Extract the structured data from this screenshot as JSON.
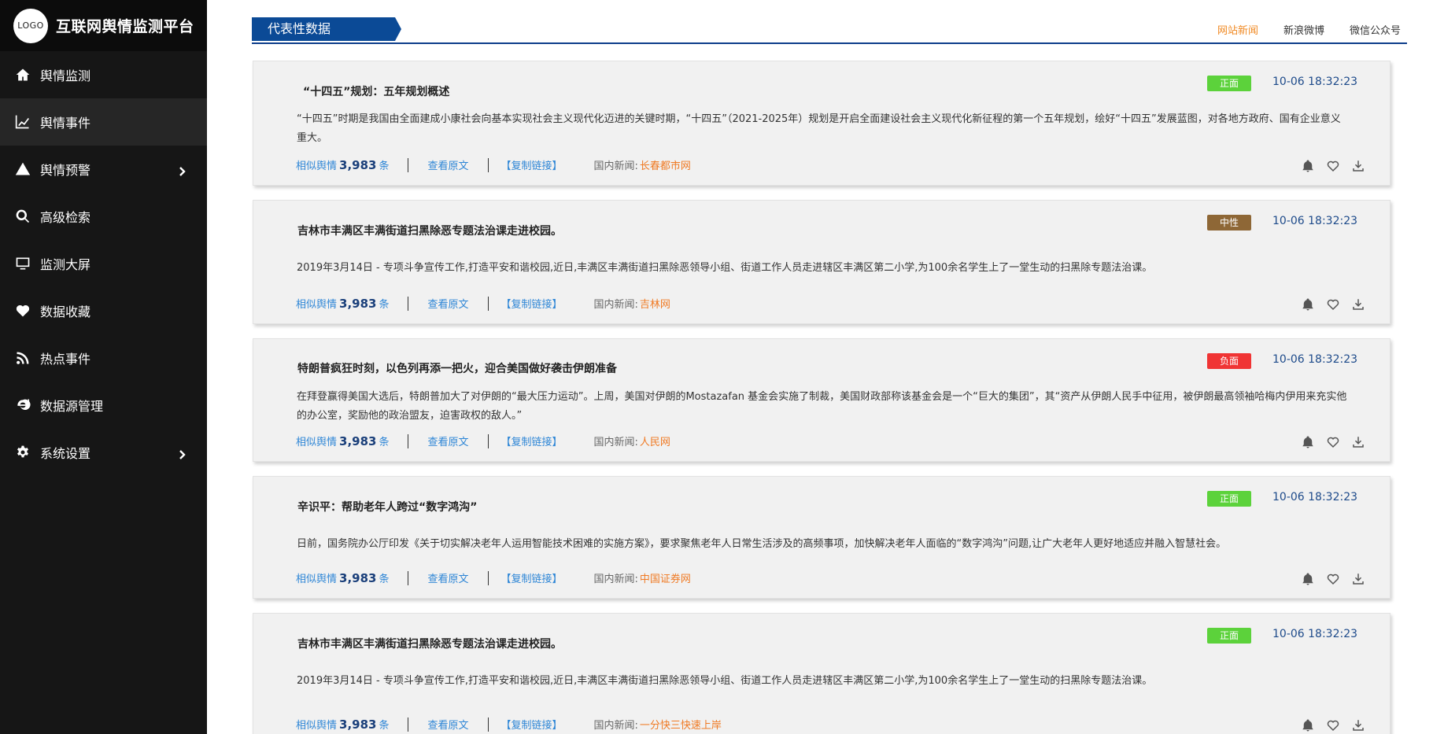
{
  "app": {
    "logo_text": "LOGO",
    "title": "互联网舆情监测平台"
  },
  "sidebar": {
    "items": [
      {
        "label": "舆情监测",
        "icon": "home-icon"
      },
      {
        "label": "舆情事件",
        "icon": "line-chart-icon"
      },
      {
        "label": "舆情预警",
        "icon": "warning-icon"
      },
      {
        "label": "高级检索",
        "icon": "search-icon"
      },
      {
        "label": "监测大屏",
        "icon": "monitor-icon"
      },
      {
        "label": "数据收藏",
        "icon": "heart-icon"
      },
      {
        "label": "热点事件",
        "icon": "rss-icon"
      },
      {
        "label": "数据源管理",
        "icon": "ie-icon"
      },
      {
        "label": "系统设置",
        "icon": "gear-icon"
      }
    ]
  },
  "header": {
    "section_title": "代表性数据",
    "filters": [
      "网站新闻",
      "新浪微博",
      "微信公众号"
    ],
    "active_filter": "网站新闻"
  },
  "labels": {
    "similar_prefix": "相似舆情",
    "similar_suffix": "条",
    "view_original": "查看原文",
    "copy_link": "【复制链接】",
    "source_label": "国内新闻:"
  },
  "colors": {
    "positive": "#5cd23b",
    "neutral": "#8e6736",
    "negative": "#f03434",
    "accent_blue": "#0b4a96",
    "active_filter": "#f08a24"
  },
  "cards": [
    {
      "title": "“十四五”规划：五年规划概述",
      "sentiment": "正面",
      "time": "10-06 18:32:23",
      "body": "“十四五”时期是我国由全面建成小康社会向基本实现社会主义现代化迈进的关键时期，“十四五”（2021-2025年）规划是开启全面建设社会主义现代化新征程的第一个五年规划，绘好“十四五”发展蓝图，对各地方政府、国有企业意义重大。",
      "similar_count": "3,983",
      "source": "长春都市网"
    },
    {
      "title": "吉林市丰满区丰满街道扫黑除恶专题法治课走进校园。",
      "sentiment": "中性",
      "time": "10-06 18:32:23",
      "body": "2019年3月14日 - 专项斗争宣传工作,打造平安和谐校园,近日,丰满区丰满街道扫黑除恶领导小组、街道工作人员走进辖区丰满区第二小学,为100余名学生上了一堂生动的扫黑除专题法治课。",
      "similar_count": "3,983",
      "source": "吉林网"
    },
    {
      "title": "特朗普疯狂时刻，以色列再添一把火，迎合美国做好袭击伊朗准备",
      "sentiment": "负面",
      "time": "10-06 18:32:23",
      "body": "在拜登赢得美国大选后，特朗普加大了对伊朗的“最大压力运动”。上周，美国对伊朗的Mostazafan 基金会实施了制裁，美国财政部称该基金会是一个“巨大的集团”，其“资产从伊朗人民手中征用，被伊朗最高领袖哈梅内伊用来充实他的办公室，奖励他的政治盟友，迫害政权的敌人。”",
      "similar_count": "3,983",
      "source": "人民网"
    },
    {
      "title": "辛识平：帮助老年人跨过“数字鸿沟”",
      "sentiment": "正面",
      "time": "10-06 18:32:23",
      "body": "日前，国务院办公厅印发《关于切实解决老年人运用智能技术困难的实施方案》，要求聚焦老年人日常生活涉及的高频事项，加快解决老年人面临的“数字鸿沟”问题,让广大老年人更好地适应并融入智慧社会。",
      "similar_count": "3,983",
      "source": "中国证券网"
    },
    {
      "title": "吉林市丰满区丰满街道扫黑除恶专题法治课走进校园。",
      "sentiment": "正面",
      "time": "10-06 18:32:23",
      "body": "2019年3月14日 - 专项斗争宣传工作,打造平安和谐校园,近日,丰满区丰满街道扫黑除恶领导小组、街道工作人员走进辖区丰满区第二小学,为100余名学生上了一堂生动的扫黑除专题法治课。",
      "similar_count": "3,983",
      "source": "一分快三快速上岸"
    }
  ]
}
